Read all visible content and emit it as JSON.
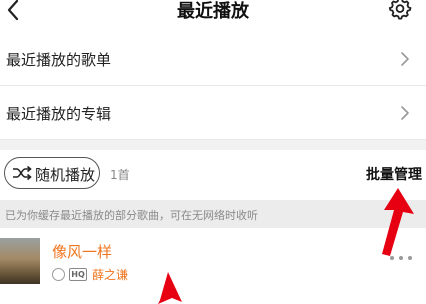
{
  "header": {
    "title": "最近播放",
    "back_icon": "chevron-left-icon",
    "settings_icon": "gear-icon"
  },
  "sections": [
    {
      "label": "最近播放的歌单"
    },
    {
      "label": "最近播放的专辑"
    }
  ],
  "toolbar": {
    "shuffle_label": "随机播放",
    "count": "1首",
    "batch_label": "批量管理"
  },
  "notice": "已为你缓存最近播放的部分歌曲，可在无网络时收听",
  "songs": [
    {
      "title": "像风一样",
      "quality_badge": "HQ",
      "artist": "薛之谦"
    }
  ],
  "colors": {
    "accent": "#f0751e",
    "annotation_arrow": "#e60012"
  }
}
